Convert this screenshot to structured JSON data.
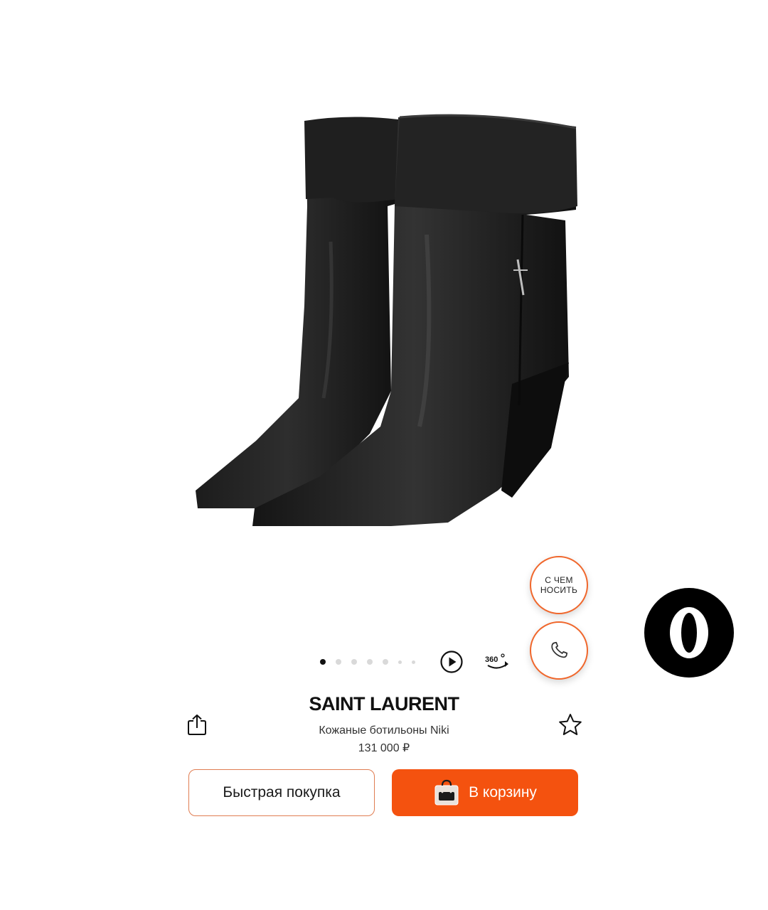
{
  "product": {
    "brand": "SAINT LAURENT",
    "name": "Кожаные ботильоны Niki",
    "price": "131 000 ₽"
  },
  "fabs": {
    "outfit_label": "С ЧЕМ НОСИТЬ",
    "call_icon": "phone-icon"
  },
  "gallery": {
    "dots_count": 7,
    "active_index": 0
  },
  "actions": {
    "quick_buy_label": "Быстрая покупка",
    "add_to_cart_label": "В корзину"
  },
  "badge": {
    "letter": "O"
  },
  "colors": {
    "accent": "#f4520f",
    "accent_border": "#f0672c"
  },
  "icons": [
    "share-icon",
    "favorite-star-icon",
    "play-icon",
    "view-360-icon",
    "shopping-bag-icon"
  ]
}
